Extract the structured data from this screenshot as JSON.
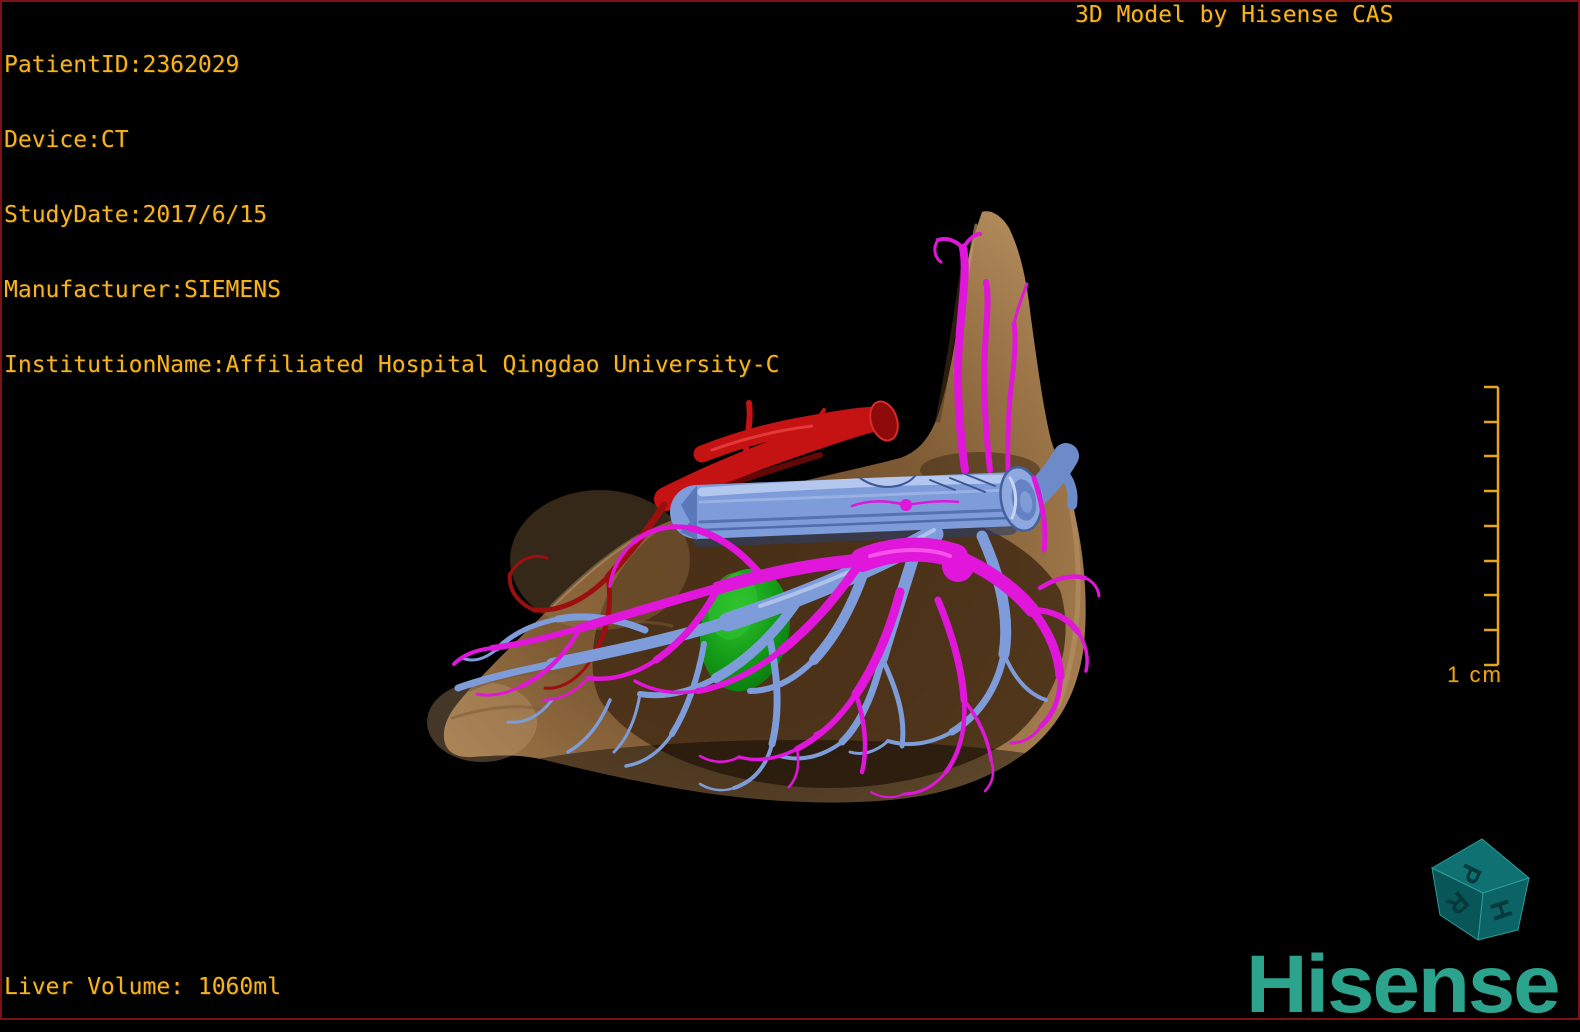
{
  "colors": {
    "background": "#000000",
    "frame_border": "#7c1214",
    "overlay_text": "#f6b51f",
    "scale_bar": "#eaa41c",
    "brand_teal": "#2ba38d",
    "cube_teal_top": "#107173",
    "cube_teal_right": "#0c6365",
    "cube_teal_left": "#095659",
    "liver_tan": "#ae865c",
    "hepatic_artery_red": "#c51212",
    "portal_vein_blue": "#7d9cd9",
    "hepatic_vein_magenta": "#e016da",
    "gallbladder_green": "#129715"
  },
  "overlay": {
    "patient_info": [
      "PatientID:2362029",
      "Device:CT",
      "StudyDate:2017/6/15",
      "Manufacturer:SIEMENS",
      "InstitutionName:Affiliated Hospital Qingdao University-C"
    ],
    "watermark": "3D Model by Hisense CAS",
    "liver_volume": "Liver Volume: 1060ml"
  },
  "scale": {
    "label": "1 cm"
  },
  "branding": {
    "wordmark": "Hisense",
    "orientation_cube": {
      "top_face": "P",
      "right_face": "H",
      "left_face": "R"
    }
  }
}
